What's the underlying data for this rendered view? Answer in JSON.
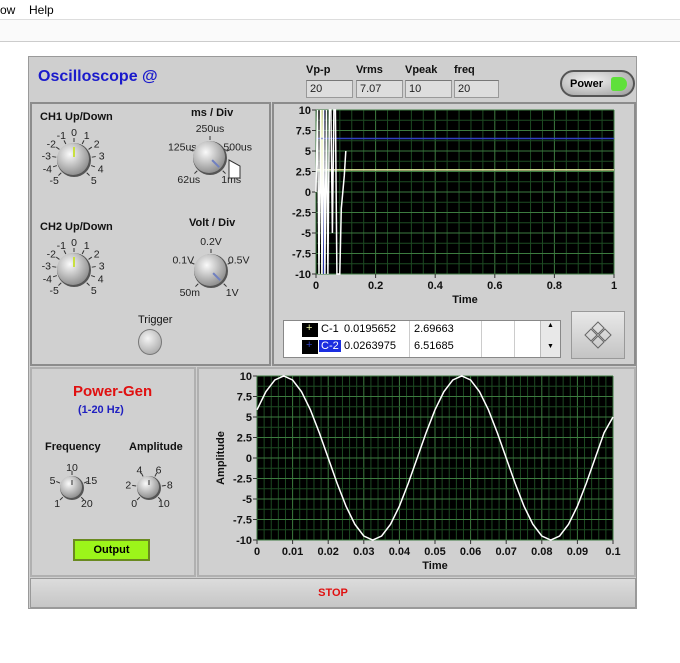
{
  "menu": {
    "items": [
      "ow",
      "Help"
    ]
  },
  "header": {
    "title": "Oscilloscope @",
    "indicators": [
      {
        "label": "Vp-p",
        "value": "20"
      },
      {
        "label": "Vrms",
        "value": "7.07"
      },
      {
        "label": "Vpeak",
        "value": "10"
      },
      {
        "label": "freq",
        "value": "20"
      }
    ],
    "power_label": "Power",
    "power_led_color": "#5fe03a"
  },
  "controls": {
    "ch1": {
      "label": "CH1 Up/Down",
      "ticks": [
        "-5",
        "-4",
        "-3",
        "-2",
        "-1",
        "0",
        "1",
        "2",
        "3",
        "4",
        "5"
      ]
    },
    "ch2": {
      "label": "CH2 Up/Down",
      "ticks": [
        "-5",
        "-4",
        "-3",
        "-2",
        "-1",
        "0",
        "1",
        "2",
        "3",
        "4",
        "5"
      ]
    },
    "ms_div": {
      "label": "ms / Div",
      "ticks": [
        "62us",
        "125us",
        "250us",
        "500us",
        "1ms"
      ]
    },
    "volt_div": {
      "label": "Volt / Div",
      "ticks": [
        "50m",
        "0.1V",
        "0.2V",
        "0.5V",
        "1V"
      ]
    },
    "trigger_label": "Trigger"
  },
  "cursor_legend": {
    "rows": [
      {
        "name": "C-1",
        "x": "0.0195652",
        "y": "2.69663"
      },
      {
        "name": "C-2",
        "x": "0.0263975",
        "y": "6.51685"
      }
    ]
  },
  "powergen": {
    "title": "Power-Gen",
    "range": "(1-20 Hz)",
    "frequency": {
      "label": "Frequency",
      "ticks": [
        "1",
        "5",
        "10",
        "15",
        "20"
      ]
    },
    "amplitude": {
      "label": "Amplitude",
      "ticks": [
        "0",
        "2",
        "4",
        "6",
        "8",
        "10"
      ]
    },
    "output_label": "Output",
    "output_color": "#9cf51a"
  },
  "stop_label": "STOP",
  "chart_data": [
    {
      "type": "line",
      "xlabel": "Time",
      "ylabel": "",
      "xlim": [
        0,
        1
      ],
      "ylim": [
        -10,
        10
      ],
      "xticks": [
        "0",
        "0.2",
        "0.4",
        "0.6",
        "0.8",
        "1"
      ],
      "yticks": [
        "10",
        "7.5",
        "5",
        "2.5",
        "0",
        "-2.5",
        "-5",
        "-7.5",
        "-10"
      ],
      "grid": true,
      "series": [
        {
          "x": [
            0.005,
            0.01,
            0.015,
            0.02,
            0.025,
            0.03,
            0.035,
            0.04,
            0.045,
            0.05,
            0.055,
            0.06,
            0.065,
            0.07,
            0.075,
            0.08,
            0.085,
            0.09,
            0.095,
            0.1
          ],
          "y": [
            10,
            -10,
            10,
            -10,
            10,
            -10,
            10,
            -10,
            10,
            10,
            -5,
            10,
            10,
            -10,
            -10,
            -10,
            -2,
            0,
            2,
            5
          ],
          "color": "#ffffff"
        }
      ],
      "cursors": [
        {
          "name": "C-1",
          "x": 0.0195652,
          "y": 2.69663,
          "color": "#e6f0a0"
        },
        {
          "name": "C-2",
          "x": 0.0263975,
          "y": 6.51685,
          "color": "#3040c0"
        }
      ]
    },
    {
      "type": "line",
      "xlabel": "Time",
      "ylabel": "Amplitude",
      "xlim": [
        0,
        0.1
      ],
      "ylim": [
        -10,
        10
      ],
      "xticks": [
        "0",
        "0.01",
        "0.02",
        "0.03",
        "0.04",
        "0.05",
        "0.06",
        "0.07",
        "0.08",
        "0.09",
        "0.1"
      ],
      "yticks": [
        "10",
        "7.5",
        "5",
        "2.5",
        "0",
        "-2.5",
        "-5",
        "-7.5",
        "-10"
      ],
      "grid": true,
      "series": [
        {
          "x": [
            0,
            0.0025,
            0.005,
            0.0075,
            0.01,
            0.0125,
            0.015,
            0.0175,
            0.02,
            0.0225,
            0.025,
            0.0275,
            0.03,
            0.0325,
            0.035,
            0.0375,
            0.04,
            0.0425,
            0.045,
            0.0475,
            0.05,
            0.0525,
            0.055,
            0.0575,
            0.06,
            0.0625,
            0.065,
            0.0675,
            0.07,
            0.0725,
            0.075,
            0.0775,
            0.08,
            0.0825,
            0.085,
            0.0875,
            0.09,
            0.0925,
            0.095,
            0.0975,
            0.1
          ],
          "y": [
            5.88,
            8.09,
            9.51,
            10,
            9.51,
            8.09,
            5.88,
            3.09,
            0,
            -3.09,
            -5.88,
            -8.09,
            -9.51,
            -10,
            -9.51,
            -8.09,
            -5.88,
            -3.09,
            0,
            3.09,
            5.88,
            8.09,
            9.51,
            10,
            9.51,
            8.09,
            5.88,
            3.09,
            0,
            -3.09,
            -5.88,
            -8.09,
            -9.51,
            -10,
            -9.51,
            -8.09,
            -5.88,
            -3.09,
            0,
            3.09,
            5.0
          ],
          "color": "#ffffff"
        }
      ]
    }
  ]
}
